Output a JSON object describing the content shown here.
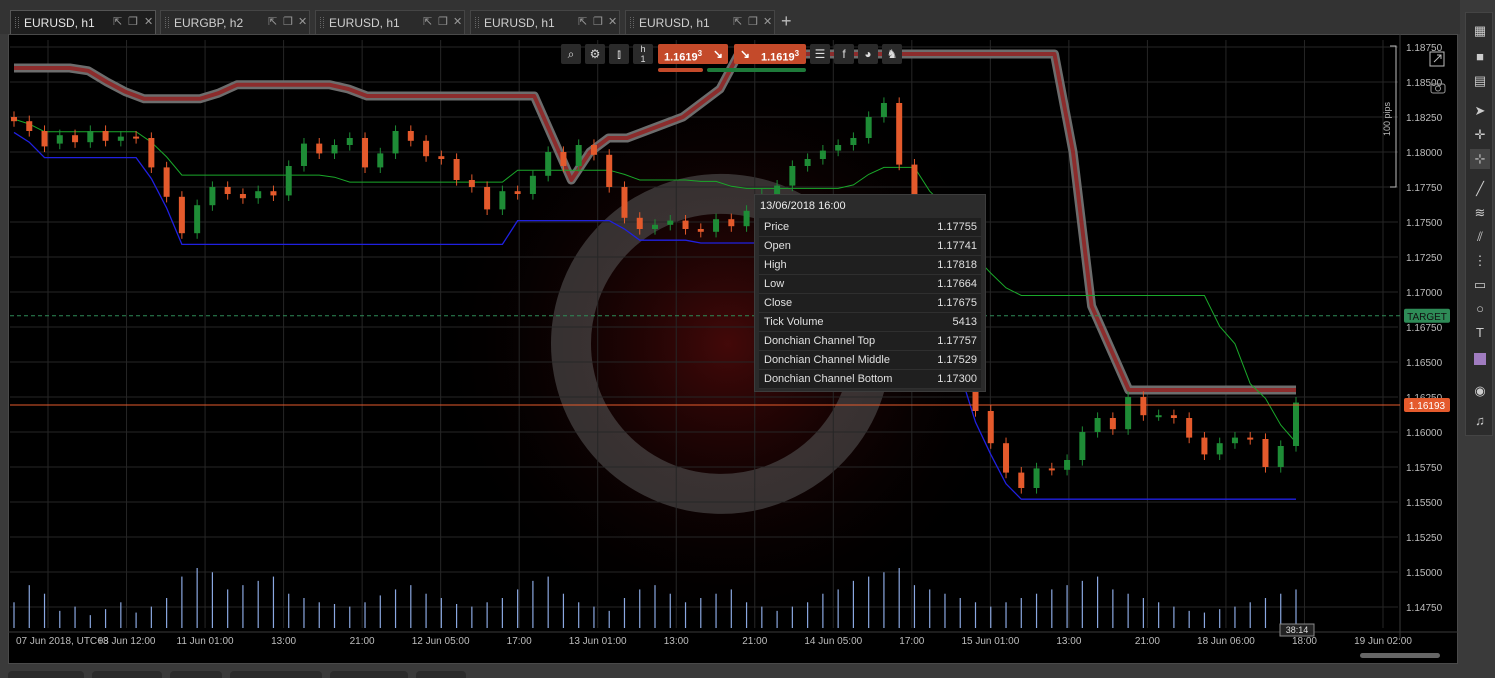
{
  "tabs": [
    {
      "label": "EURUSD, h1",
      "active": true
    },
    {
      "label": "EURGBP, h2",
      "active": false
    },
    {
      "label": "EURUSD, h1",
      "active": false
    },
    {
      "label": "EURUSD, h1",
      "active": false
    },
    {
      "label": "EURUSD, h1",
      "active": false
    }
  ],
  "toolbar": {
    "sell_price": "1.1619",
    "sell_price_sup": "3",
    "buy_price": "1.1619",
    "buy_price_sup": "3",
    "timeframe": "h",
    "timeframe_n": "1",
    "icons": [
      "zoom-icon",
      "chart-settings-icon",
      "candles-icon",
      "timeframe-icon",
      "list-icon",
      "facebook-icon",
      "pie-icon",
      "trader-icon"
    ]
  },
  "colors": {
    "bull": "#1e8c36",
    "bear": "#e45a2c",
    "top_line": "#8c2c2c",
    "middle_line": "#1aa82a",
    "bottom_line": "#2020e0",
    "target": "#2e8b57",
    "current_price": "#e45a2c",
    "volume": "#8aa7e0"
  },
  "price_axis": {
    "labels": [
      "1.18750",
      "1.18500",
      "1.18250",
      "1.18000",
      "1.17750",
      "1.17500",
      "1.17250",
      "1.17000",
      "1.16750",
      "1.16500",
      "1.16250",
      "1.16000",
      "1.15750",
      "1.15500",
      "1.15250",
      "1.15000",
      "1.14750"
    ],
    "target_label": "TARGET",
    "current_price_label": "1.16193",
    "pips_label": "100 pips"
  },
  "time_axis": {
    "labels": [
      "07 Jun 2018, UTC+3",
      "08 Jun 12:00",
      "11 Jun 01:00",
      "13:00",
      "21:00",
      "12 Jun 05:00",
      "17:00",
      "13 Jun 01:00",
      "13:00",
      "21:00",
      "14 Jun 05:00",
      "17:00",
      "15 Jun 01:00",
      "13:00",
      "21:00",
      "18 Jun 06:00",
      "18:00",
      "19 Jun 02:00"
    ],
    "countdown": "38:14"
  },
  "tooltip": {
    "date": "13/06/2018 16:00",
    "rows": [
      {
        "label": "Price",
        "value": "1.17755"
      },
      {
        "label": "Open",
        "value": "1.17741"
      },
      {
        "label": "High",
        "value": "1.17818"
      },
      {
        "label": "Low",
        "value": "1.17664"
      },
      {
        "label": "Close",
        "value": "1.17675"
      },
      {
        "label": "Tick Volume",
        "value": "5413"
      },
      {
        "label": "Donchian Channel Top",
        "value": "1.17757"
      },
      {
        "label": "Donchian Channel Middle",
        "value": "1.17529"
      },
      {
        "label": "Donchian Channel Bottom",
        "value": "1.17300"
      }
    ]
  },
  "chart_data": {
    "type": "candlestick",
    "symbol": "EURUSD",
    "timeframe": "h1",
    "ylim": [
      1.146,
      1.188
    ],
    "target_price": 1.1683,
    "current_price": 1.16193,
    "candles": [
      [
        1.1825,
        1.1822
      ],
      [
        1.1822,
        1.1815
      ],
      [
        1.1815,
        1.1804
      ],
      [
        1.1806,
        1.1812
      ],
      [
        1.1812,
        1.1807
      ],
      [
        1.1807,
        1.1815
      ],
      [
        1.1815,
        1.1808
      ],
      [
        1.1808,
        1.1811
      ],
      [
        1.1811,
        1.181
      ],
      [
        1.181,
        1.1789
      ],
      [
        1.1789,
        1.1768
      ],
      [
        1.1768,
        1.1742
      ],
      [
        1.1742,
        1.1762
      ],
      [
        1.1762,
        1.1775
      ],
      [
        1.1775,
        1.177
      ],
      [
        1.177,
        1.1767
      ],
      [
        1.1767,
        1.1772
      ],
      [
        1.1772,
        1.1769
      ],
      [
        1.1769,
        1.179
      ],
      [
        1.179,
        1.1806
      ],
      [
        1.1806,
        1.1799
      ],
      [
        1.1799,
        1.1805
      ],
      [
        1.1805,
        1.181
      ],
      [
        1.181,
        1.1789
      ],
      [
        1.1789,
        1.1799
      ],
      [
        1.1799,
        1.1815
      ],
      [
        1.1815,
        1.1808
      ],
      [
        1.1808,
        1.1797
      ],
      [
        1.1797,
        1.1795
      ],
      [
        1.1795,
        1.178
      ],
      [
        1.178,
        1.1775
      ],
      [
        1.1775,
        1.1759
      ],
      [
        1.1759,
        1.1772
      ],
      [
        1.1772,
        1.177
      ],
      [
        1.177,
        1.1783
      ],
      [
        1.1783,
        1.18
      ],
      [
        1.18,
        1.179
      ],
      [
        1.179,
        1.1805
      ],
      [
        1.1805,
        1.1798
      ],
      [
        1.1798,
        1.1775
      ],
      [
        1.1775,
        1.1753
      ],
      [
        1.1753,
        1.1745
      ],
      [
        1.1745,
        1.1748
      ],
      [
        1.1748,
        1.1751
      ],
      [
        1.1751,
        1.1745
      ],
      [
        1.1745,
        1.1743
      ],
      [
        1.1743,
        1.1752
      ],
      [
        1.1752,
        1.1747
      ],
      [
        1.1747,
        1.1758
      ],
      [
        1.1758,
        1.177
      ],
      [
        1.177,
        1.1776
      ],
      [
        1.1776,
        1.179
      ],
      [
        1.179,
        1.1795
      ],
      [
        1.1795,
        1.1801
      ],
      [
        1.1801,
        1.1805
      ],
      [
        1.1805,
        1.181
      ],
      [
        1.181,
        1.1825
      ],
      [
        1.1825,
        1.1835
      ],
      [
        1.1835,
        1.1791
      ],
      [
        1.1791,
        1.1766
      ],
      [
        1.1766,
        1.1709
      ],
      [
        1.1709,
        1.1688
      ],
      [
        1.1688,
        1.165
      ],
      [
        1.165,
        1.1615
      ],
      [
        1.1615,
        1.1592
      ],
      [
        1.1592,
        1.1571
      ],
      [
        1.1571,
        1.156
      ],
      [
        1.156,
        1.1574
      ],
      [
        1.1574,
        1.1573
      ],
      [
        1.1573,
        1.158
      ],
      [
        1.158,
        1.16
      ],
      [
        1.16,
        1.161
      ],
      [
        1.161,
        1.1602
      ],
      [
        1.1602,
        1.1625
      ],
      [
        1.1625,
        1.1612
      ],
      [
        1.1612,
        1.1612
      ],
      [
        1.1612,
        1.161
      ],
      [
        1.161,
        1.1596
      ],
      [
        1.1596,
        1.1584
      ],
      [
        1.1584,
        1.1592
      ],
      [
        1.1592,
        1.1596
      ],
      [
        1.1596,
        1.1595
      ],
      [
        1.1595,
        1.1575
      ],
      [
        1.1575,
        1.159
      ],
      [
        1.159,
        1.1621
      ]
    ],
    "donchian_top": [
      1.186,
      1.186,
      1.186,
      1.186,
      1.1858,
      1.185,
      1.1843,
      1.1838,
      1.1838,
      1.1838,
      1.1838,
      1.1842,
      1.1848,
      1.1848,
      1.1848,
      1.1848,
      1.1848,
      1.1848,
      1.1845,
      1.184,
      1.184,
      1.184,
      1.184,
      1.184,
      1.184,
      1.184,
      1.184,
      1.184,
      1.184,
      1.181,
      1.178,
      1.18,
      1.181,
      1.181,
      1.1815,
      1.182,
      1.1825,
      1.1835,
      1.1845,
      1.187,
      1.187,
      1.187,
      1.187,
      1.187,
      1.187,
      1.187,
      1.187,
      1.187,
      1.187,
      1.187,
      1.187,
      1.187,
      1.187,
      1.187,
      1.187,
      1.187,
      1.187,
      1.18,
      1.169,
      1.166,
      1.163,
      1.163,
      1.163,
      1.163,
      1.163,
      1.163,
      1.163,
      1.163,
      1.163,
      1.163
    ],
    "volume": [
      30,
      50,
      40,
      20,
      25,
      15,
      22,
      30,
      18,
      25,
      35,
      60,
      70,
      65,
      45,
      50,
      55,
      60,
      40,
      35,
      30,
      28,
      25,
      30,
      38,
      45,
      50,
      40,
      35,
      28,
      25,
      30,
      35,
      45,
      55,
      60,
      40,
      30,
      25,
      20,
      35,
      45,
      50,
      40,
      30,
      35,
      40,
      45,
      30,
      25,
      20,
      25,
      30,
      40,
      45,
      55,
      60,
      65,
      70,
      50,
      45,
      40,
      35,
      30,
      25,
      30,
      35,
      40,
      45,
      50,
      55,
      60,
      45,
      40,
      35,
      30,
      25,
      20,
      18,
      22,
      25,
      30,
      35,
      40,
      45
    ]
  }
}
